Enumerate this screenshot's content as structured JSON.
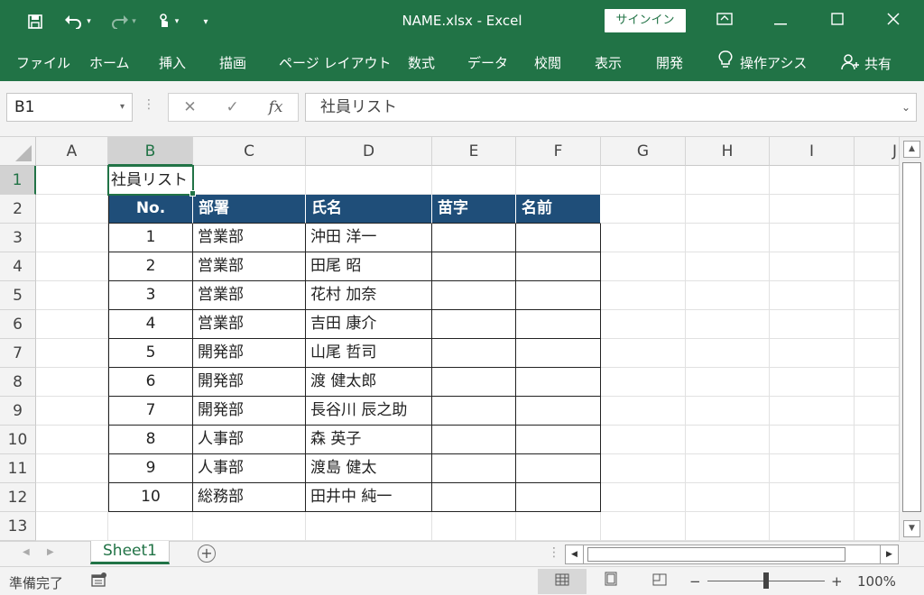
{
  "titlebar": {
    "title": "NAME.xlsx  -  Excel",
    "signin": "サインイン",
    "save_icon": "save-icon",
    "undo_icon": "undo-icon",
    "redo_icon": "redo-icon",
    "touch_icon": "touch-mode-icon",
    "customize_icon": "customize-qat-icon"
  },
  "ribbon": {
    "tabs": [
      "ファイル",
      "ホーム",
      "挿入",
      "描画",
      "ページ レイアウト",
      "数式",
      "データ",
      "校閲",
      "表示",
      "開発"
    ],
    "tellme": "操作アシス",
    "share": "共有"
  },
  "formula_bar": {
    "name_box": "B1",
    "fx": "fx",
    "content": "社員リスト"
  },
  "columns": [
    "A",
    "B",
    "C",
    "D",
    "E",
    "F",
    "G",
    "H",
    "I",
    "J"
  ],
  "rows": [
    "1",
    "2",
    "3",
    "4",
    "5",
    "6",
    "7",
    "8",
    "9",
    "10",
    "11",
    "12",
    "13"
  ],
  "sheet": {
    "title_cell": "社員リスト",
    "headers": [
      "No.",
      "部署",
      "氏名",
      "苗字",
      "名前"
    ],
    "data": [
      [
        "1",
        "営業部",
        "沖田 洋一",
        "",
        ""
      ],
      [
        "2",
        "営業部",
        "田尾 昭",
        "",
        ""
      ],
      [
        "3",
        "営業部",
        "花村 加奈",
        "",
        ""
      ],
      [
        "4",
        "営業部",
        "吉田 康介",
        "",
        ""
      ],
      [
        "5",
        "開発部",
        "山尾 哲司",
        "",
        ""
      ],
      [
        "6",
        "開発部",
        "渡 健太郎",
        "",
        ""
      ],
      [
        "7",
        "開発部",
        "長谷川 辰之助",
        "",
        ""
      ],
      [
        "8",
        "人事部",
        "森 英子",
        "",
        ""
      ],
      [
        "9",
        "人事部",
        "渡島 健太",
        "",
        ""
      ],
      [
        "10",
        "総務部",
        "田井中 純一",
        "",
        ""
      ]
    ]
  },
  "sheet_tabs": {
    "active": "Sheet1"
  },
  "status": {
    "ready": "準備完了",
    "zoom": "100%",
    "minus": "−",
    "plus": "+"
  },
  "colors": {
    "accent": "#217346",
    "header_fill": "#1f4e79"
  }
}
